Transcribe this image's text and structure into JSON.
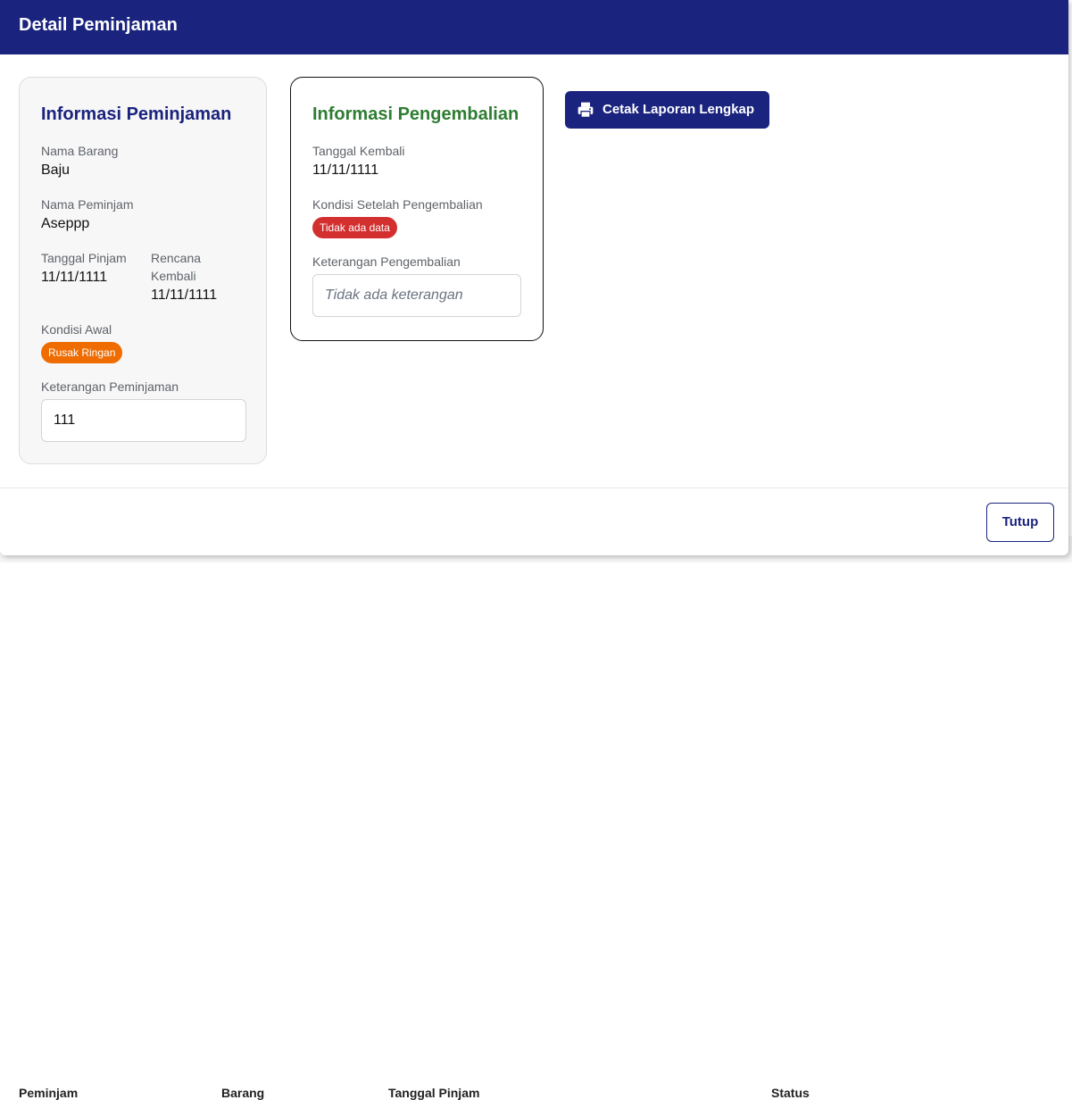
{
  "modal": {
    "title": "Detail Peminjaman",
    "close_label": "Tutup"
  },
  "loan_info": {
    "title": "Informasi Peminjaman",
    "item_label": "Nama Barang",
    "item_value": "Baju",
    "borrower_label": "Nama Peminjam",
    "borrower_value": "Aseppp",
    "borrow_date_label": "Tanggal Pinjam",
    "borrow_date_value": "11/11/1111",
    "plan_return_label_1": "Rencana",
    "plan_return_label_2": "Kembali",
    "plan_return_value": "11/11/1111",
    "initial_condition_label": "Kondisi Awal",
    "initial_condition_value": "Rusak Ringan",
    "notes_label": "Keterangan Peminjaman",
    "notes_value": "111"
  },
  "return_info": {
    "title": "Informasi Pengembalian",
    "return_date_label": "Tanggal Kembali",
    "return_date_value": "11/11/1111",
    "condition_label": "Kondisi Setelah Pengembalian",
    "condition_value": "Tidak ada data",
    "notes_label": "Keterangan Pengembalian",
    "notes_value": "Tidak ada keterangan"
  },
  "actions": {
    "print_label": "Cetak Laporan Lengkap",
    "print_icon": "printer-icon"
  },
  "background_table": {
    "columns": [
      "Peminjam",
      "Barang",
      "Tanggal Pinjam",
      "Status"
    ]
  },
  "colors": {
    "header": "#1a237e",
    "loan_title": "#1a237e",
    "return_title": "#2e7d32",
    "badge_warning": "#ef6c00",
    "badge_danger": "#d32f2f"
  }
}
